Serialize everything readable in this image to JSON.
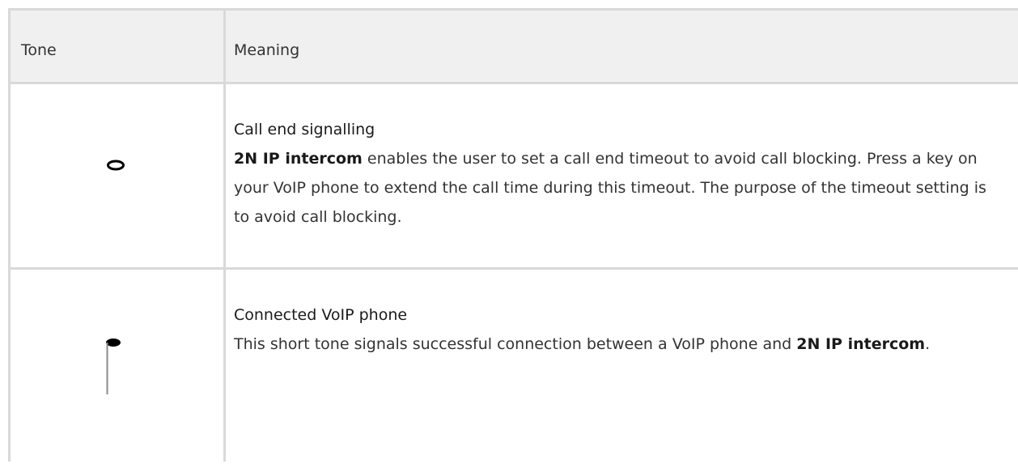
{
  "table": {
    "headers": {
      "tone": "Tone",
      "meaning": "Meaning"
    },
    "rows": [
      {
        "icon": "whole-note-icon",
        "title": "Call end signalling",
        "desc_bold": "2N IP intercom",
        "desc_rest": " enables the user to set a call end timeout to avoid call blocking. Press a key on your VoIP phone to extend the call time during this timeout. The purpose of the timeout setting is to avoid call blocking."
      },
      {
        "icon": "eighth-note-icon",
        "title": "Connected VoIP phone",
        "desc_pre": "This short tone signals successful connection between a VoIP phone and ",
        "desc_bold": "2N IP intercom",
        "desc_post": "."
      }
    ]
  }
}
